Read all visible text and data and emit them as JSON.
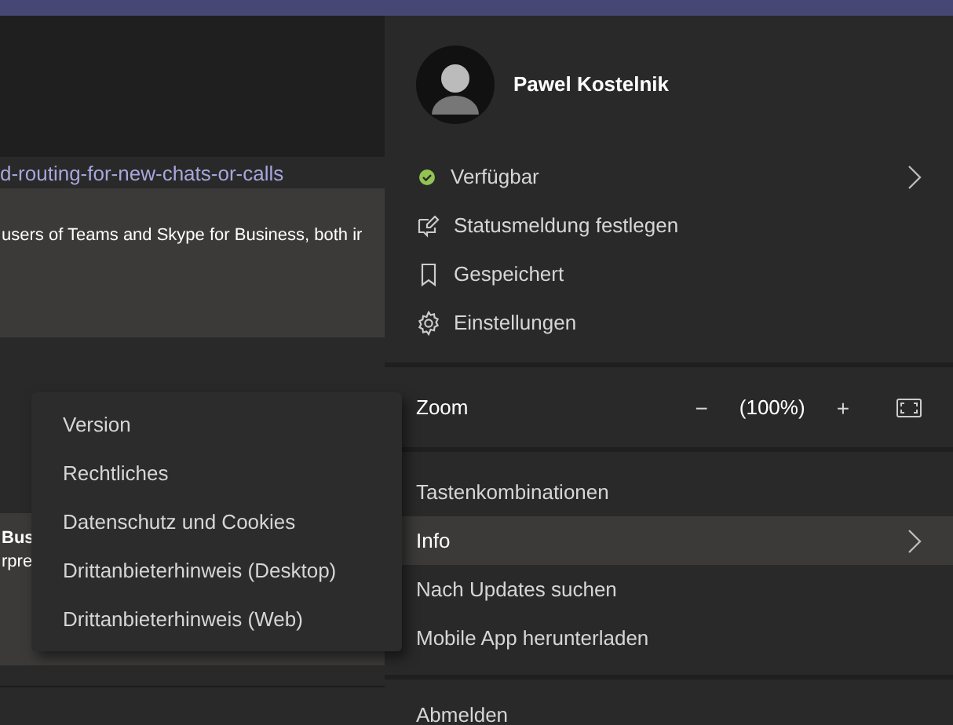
{
  "background": {
    "link": "d-routing-for-new-chats-or-calls",
    "cards": [
      {
        "text": "users of Teams and Skype for Business, both ir"
      },
      {
        "title": "Bus",
        "text": "rpre"
      }
    ]
  },
  "profile_menu": {
    "name": "Pawel Kostelnik",
    "status": {
      "label": "Verfügbar",
      "color": "#92c353"
    },
    "items": [
      {
        "kind": "status-message",
        "label": "Statusmeldung festlegen"
      },
      {
        "kind": "saved",
        "label": "Gespeichert"
      },
      {
        "kind": "settings",
        "label": "Einstellungen"
      }
    ],
    "zoom": {
      "label": "Zoom",
      "minus": "−",
      "value": "(100%)",
      "plus": "+"
    },
    "links": [
      {
        "label": "Tastenkombinationen",
        "selected": false,
        "submenu": false
      },
      {
        "label": "Info",
        "selected": true,
        "submenu": true
      },
      {
        "label": "Nach Updates suchen",
        "selected": false,
        "submenu": false
      },
      {
        "label": "Mobile App herunterladen",
        "selected": false,
        "submenu": false
      }
    ],
    "sign_out": "Abmelden"
  },
  "info_submenu": [
    "Version",
    "Rechtliches",
    "Datenschutz und Cookies",
    "Drittanbieterhinweis (Desktop)",
    "Drittanbieterhinweis (Web)"
  ]
}
